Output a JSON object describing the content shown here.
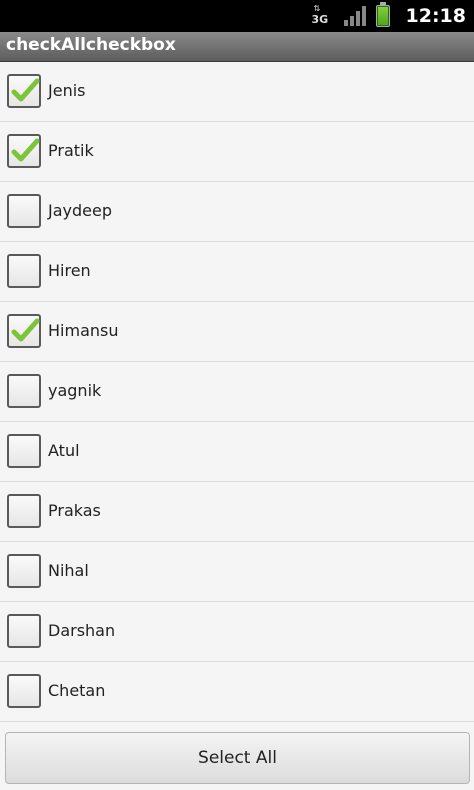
{
  "status_bar": {
    "network_label": "3G",
    "network_arrows": "⇅",
    "time": "12:18",
    "icons": [
      "network-3g-icon",
      "signal-icon",
      "battery-charging-icon"
    ]
  },
  "app": {
    "title": "checkAllcheckbox"
  },
  "list": {
    "items": [
      {
        "label": "Jenis",
        "checked": true
      },
      {
        "label": "Pratik",
        "checked": true
      },
      {
        "label": "Jaydeep",
        "checked": false
      },
      {
        "label": "Hiren",
        "checked": false
      },
      {
        "label": "Himansu",
        "checked": true
      },
      {
        "label": "yagnik",
        "checked": false
      },
      {
        "label": "Atul",
        "checked": false
      },
      {
        "label": "Prakas",
        "checked": false
      },
      {
        "label": "Nihal",
        "checked": false
      },
      {
        "label": "Darshan",
        "checked": false
      },
      {
        "label": "Chetan",
        "checked": false
      }
    ]
  },
  "button": {
    "select_all_label": "Select All"
  },
  "colors": {
    "check_green": "#7cc43a",
    "status_bar": "#000000",
    "title_bar": "#6e6e6e"
  }
}
